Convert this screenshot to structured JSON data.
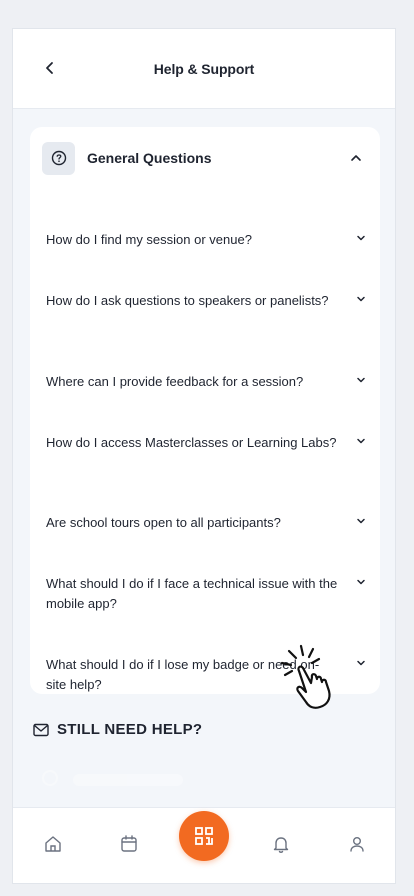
{
  "header": {
    "title": "Help & Support",
    "back_icon": "chevron-left-icon"
  },
  "section": {
    "title": "General Questions",
    "icon": "question-circle-icon",
    "expanded": true,
    "items": [
      {
        "question": "How do I find my session or venue?"
      },
      {
        "question": "How do I ask questions to speakers or panelists?"
      },
      {
        "question": "Where can I provide feedback for a session?"
      },
      {
        "question": "How do I access Masterclasses or Learning Labs?"
      },
      {
        "question": "Are school tours open to all participants?"
      },
      {
        "question": "What should I do if I face a technical issue with the mobile app?"
      },
      {
        "question": "What should I do if I lose my badge or need on-site help?"
      }
    ]
  },
  "help": {
    "title": "STILL NEED HELP?",
    "icon": "mail-icon"
  },
  "bottom_nav": {
    "items": [
      "home-icon",
      "calendar-icon",
      "qr-scan-icon",
      "bell-icon",
      "profile-icon"
    ],
    "accent": "#f26a21"
  }
}
